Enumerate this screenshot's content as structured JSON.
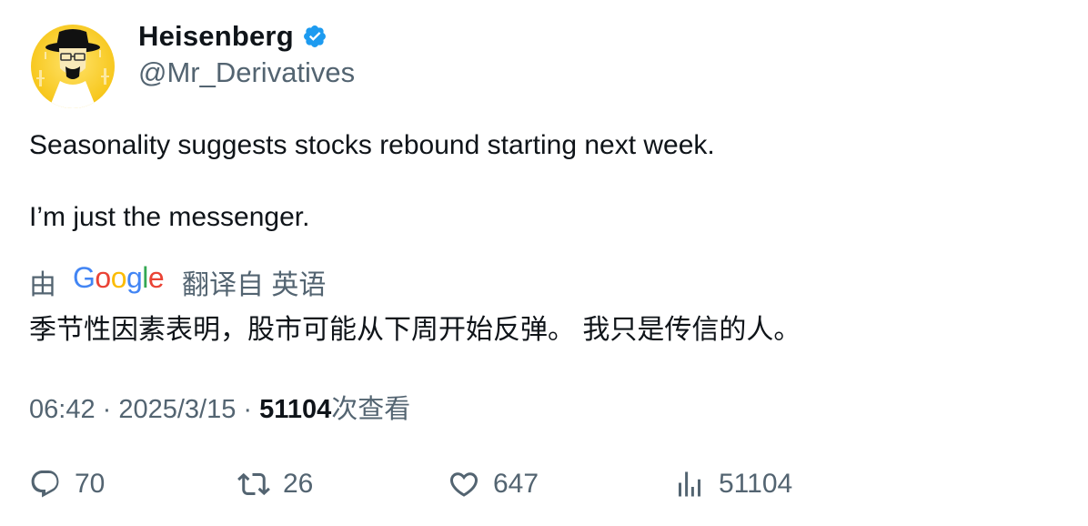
{
  "author": {
    "display_name": "Heisenberg",
    "handle": "@Mr_Derivatives",
    "verified_color": "#1d9bf0",
    "avatar_background": "#f7c71c"
  },
  "tweet": {
    "line1": "Seasonality suggests stocks rebound starting next week.",
    "line2": "I’m just the messenger."
  },
  "translation": {
    "prefix": "由",
    "provider_logo": "Google",
    "suffix": "翻译自 英语",
    "text": "季节性因素表明，股市可能从下周开始反弹。 我只是传信的人。"
  },
  "meta": {
    "time": "06:42",
    "separator1": " · ",
    "date": "2025/3/15",
    "separator2": " · ",
    "views": "51104",
    "views_label": "次查看"
  },
  "actions": {
    "replies": {
      "icon": "reply-icon",
      "count": "70"
    },
    "retweets": {
      "icon": "retweet-icon",
      "count": "26"
    },
    "likes": {
      "icon": "heart-icon",
      "count": "647"
    },
    "views": {
      "icon": "analytics-icon",
      "count": "51104"
    }
  },
  "colors": {
    "text": "#0f1419",
    "secondary": "#536471",
    "google_blue": "#4285f4",
    "google_red": "#ea4335",
    "google_yellow": "#fbbc05",
    "google_green": "#34a853"
  }
}
